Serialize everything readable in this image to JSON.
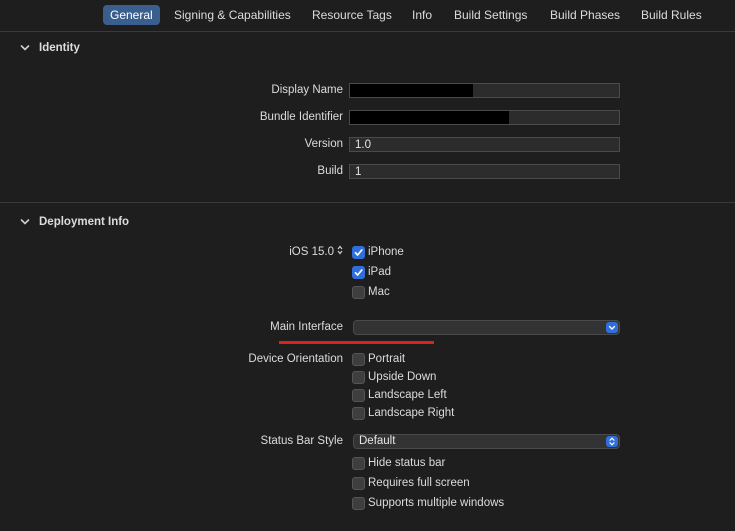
{
  "tabs": [
    {
      "label": "General",
      "active": true
    },
    {
      "label": "Signing & Capabilities"
    },
    {
      "label": "Resource Tags"
    },
    {
      "label": "Info"
    },
    {
      "label": "Build Settings"
    },
    {
      "label": "Build Phases"
    },
    {
      "label": "Build Rules"
    }
  ],
  "identity": {
    "title": "Identity",
    "display_name_label": "Display Name",
    "display_name_value": "",
    "bundle_identifier_label": "Bundle Identifier",
    "bundle_identifier_value": "",
    "version_label": "Version",
    "version_value": "1.0",
    "build_label": "Build",
    "build_value": "1"
  },
  "deployment": {
    "title": "Deployment Info",
    "ios_version": "iOS 15.0",
    "devices": [
      {
        "label": "iPhone",
        "checked": true
      },
      {
        "label": "iPad",
        "checked": true
      },
      {
        "label": "Mac",
        "checked": false
      }
    ],
    "main_interface_label": "Main Interface",
    "main_interface_value": "",
    "device_orientation_label": "Device Orientation",
    "orientations": [
      {
        "label": "Portrait",
        "checked": false
      },
      {
        "label": "Upside Down",
        "checked": false
      },
      {
        "label": "Landscape Left",
        "checked": false
      },
      {
        "label": "Landscape Right",
        "checked": false
      }
    ],
    "status_bar_style_label": "Status Bar Style",
    "status_bar_style_value": "Default",
    "status_options": [
      {
        "label": "Hide status bar",
        "checked": false
      },
      {
        "label": "Requires full screen",
        "checked": false
      },
      {
        "label": "Supports multiple windows",
        "checked": false
      }
    ]
  },
  "colors": {
    "accent": "#2f6fdc",
    "annotation": "#e0201b",
    "active_tab": "#3a5f8f"
  }
}
